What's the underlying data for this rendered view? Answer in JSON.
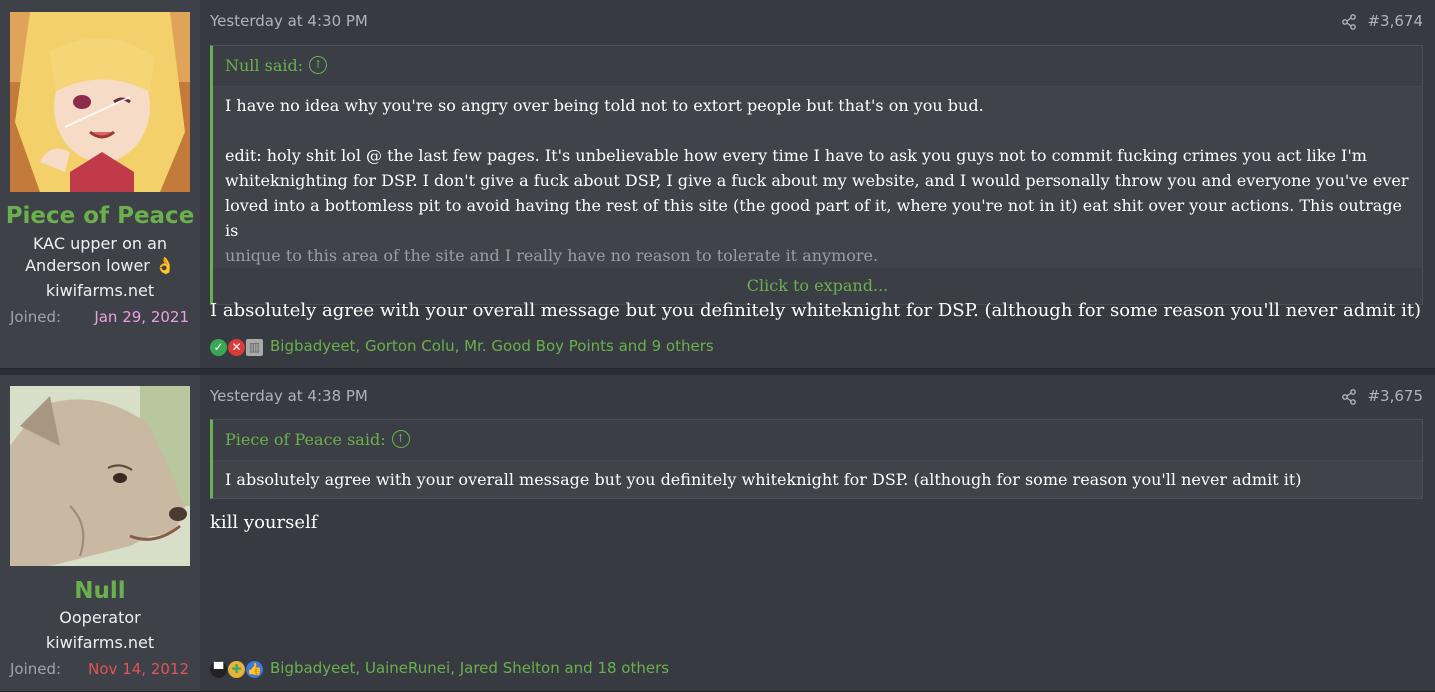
{
  "posts": [
    {
      "user": {
        "name": "Piece of Peace",
        "title_line1": "KAC upper on an",
        "title_line2": "Anderson lower 👌",
        "site": "kiwifarms.net",
        "joined_label": "Joined:",
        "joined_date": "Jan 29, 2021",
        "joined_color": "#e9a0e0"
      },
      "date": "Yesterday at 4:30 PM",
      "number": "#3,674",
      "quote": {
        "author": "Null said:",
        "paragraph1": "I have no idea why you're so angry over being told not to extort people but that's on you bud.",
        "paragraph2_line1": "edit: holy shit lol @ the last few pages. It's unbelievable how every time I have to ask you guys not to commit fucking crimes you act like I'm",
        "paragraph2_line2": "whiteknighting for DSP. I don't give a fuck about DSP, I give a fuck about my website, and I would personally throw you and everyone you've ever",
        "paragraph2_line3": "loved into a bottomless pit to avoid having the rest of this site (the good part of it, where you're not in it) eat shit over your actions. This outrage is",
        "paragraph2_line4": "unique to this area of the site and I really have no reason to tolerate it anymore.",
        "expand": "Click to expand..."
      },
      "message": "I absolutely agree with your overall message but you definitely whiteknight for DSP. (although for some reason you'll never admit it)",
      "reactions": {
        "icons": [
          "check-icon",
          "x-icon",
          "striped-icon"
        ],
        "text": "Bigbadyeet, Gorton Colu, Mr. Good Boy Points and 9 others"
      }
    },
    {
      "user": {
        "name": "Null",
        "title_line1": "Ooperator",
        "site": "kiwifarms.net",
        "joined_label": "Joined:",
        "joined_date": "Nov 14, 2012",
        "joined_color": "#e05555"
      },
      "date": "Yesterday at 4:38 PM",
      "number": "#3,675",
      "quote": {
        "author": "Piece of Peace said:",
        "paragraph1": "I absolutely agree with your overall message but you definitely whiteknight for DSP. (although for some reason you'll never admit it)"
      },
      "message": "kill yourself",
      "reactions": {
        "icons": [
          "top-hat-icon",
          "puzzle-icon",
          "like-icon"
        ],
        "text": "Bigbadyeet, UaineRunei, Jared Shelton and 18 others"
      }
    }
  ],
  "colors": {
    "accent": "#6ab04c",
    "background": "#373a41",
    "user_panel": "#3e4148"
  }
}
